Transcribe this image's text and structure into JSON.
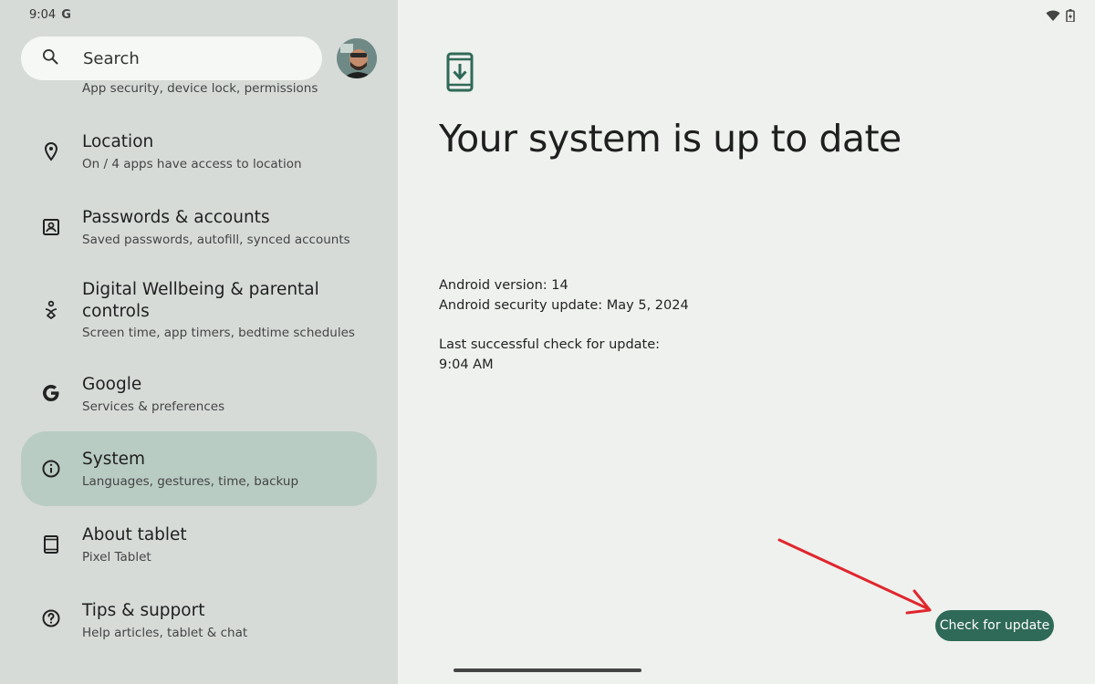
{
  "status": {
    "time": "9:04",
    "g_glyph": "G",
    "wifi_icon": "wifi-icon",
    "battery_icon": "battery-charging-icon"
  },
  "search": {
    "label": "Search",
    "icon": "search-icon"
  },
  "avatar": {
    "icon": "avatar"
  },
  "partial": {
    "subtitle": "App security, device lock, permissions"
  },
  "sidebar": {
    "items": [
      {
        "title": "Location",
        "subtitle": "On / 4 apps have access to location",
        "icon": "location-pin-icon"
      },
      {
        "title": "Passwords & accounts",
        "subtitle": "Saved passwords, autofill, synced accounts",
        "icon": "account-box-icon"
      },
      {
        "title": "Digital Wellbeing & parental controls",
        "subtitle": "Screen time, app timers, bedtime schedules",
        "icon": "wellbeing-icon"
      },
      {
        "title": "Google",
        "subtitle": "Services & preferences",
        "icon": "google-icon"
      },
      {
        "title": "System",
        "subtitle": "Languages, gestures, time, backup",
        "icon": "info-icon",
        "active": true
      },
      {
        "title": "About tablet",
        "subtitle": "Pixel Tablet",
        "icon": "tablet-icon"
      },
      {
        "title": "Tips & support",
        "subtitle": "Help articles, tablet & chat",
        "icon": "help-icon"
      }
    ]
  },
  "main": {
    "headline": "Your system is up to date",
    "android_version": "Android version: 14",
    "security_update": "Android security update: May 5, 2024",
    "last_check_label": "Last successful check for update:",
    "last_check_time": "9:04 AM",
    "check_button": "Check for update"
  },
  "colors": {
    "accent": "#2f6957",
    "active_item": "#b9ccc4",
    "sidebar_bg": "#d6dbd8",
    "main_bg": "#eef1ee",
    "annotation_arrow": "#e0262d"
  }
}
